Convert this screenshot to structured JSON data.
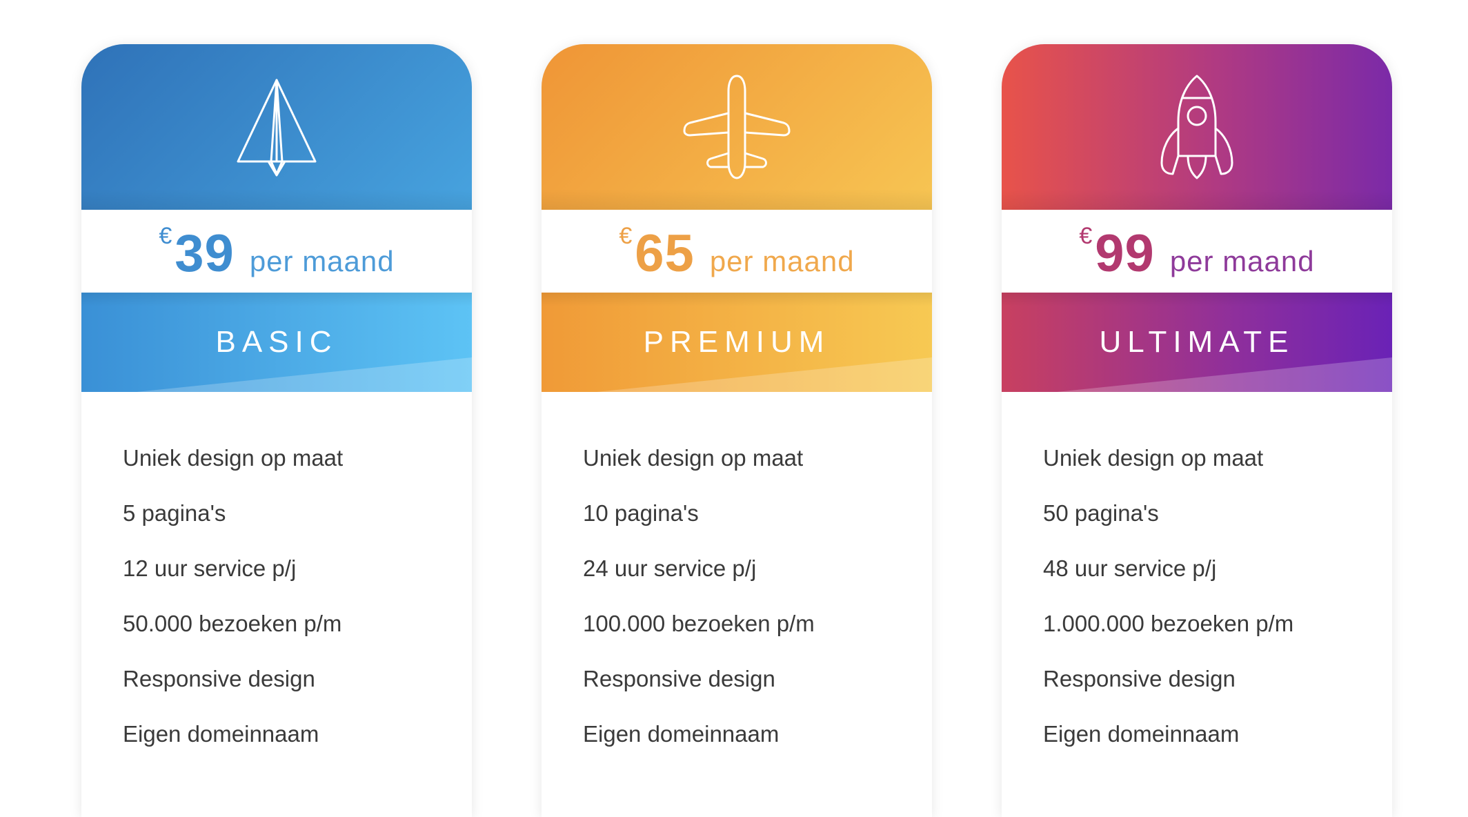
{
  "plans": [
    {
      "icon": "paper-plane-icon",
      "currency": "€",
      "amount": "39",
      "period": "per maand",
      "name": "BASIC",
      "features": [
        "Uniek design op maat",
        "5 pagina's",
        "12 uur service p/j",
        "50.000 bezoeken p/m",
        "Responsive design",
        "Eigen domeinnaam"
      ]
    },
    {
      "icon": "airplane-icon",
      "currency": "€",
      "amount": "65",
      "period": "per maand",
      "name": "PREMIUM",
      "features": [
        "Uniek design op maat",
        "10 pagina's",
        "24 uur service p/j",
        "100.000 bezoeken p/m",
        "Responsive design",
        "Eigen domeinnaam"
      ]
    },
    {
      "icon": "rocket-icon",
      "currency": "€",
      "amount": "99",
      "period": "per maand",
      "name": "ULTIMATE",
      "features": [
        "Uniek design op maat",
        "50 pagina's",
        "48 uur service p/j",
        "1.000.000 bezoeken p/m",
        "Responsive design",
        "Eigen domeinnaam"
      ]
    }
  ],
  "colors": {
    "basic_start": "#2f72b8",
    "basic_end": "#5dc3f5",
    "premium_start": "#ef9536",
    "premium_end": "#f7c553",
    "ultimate_start": "#e8534a",
    "ultimate_end": "#6a22b6",
    "feature_text": "#3a3a3a"
  }
}
